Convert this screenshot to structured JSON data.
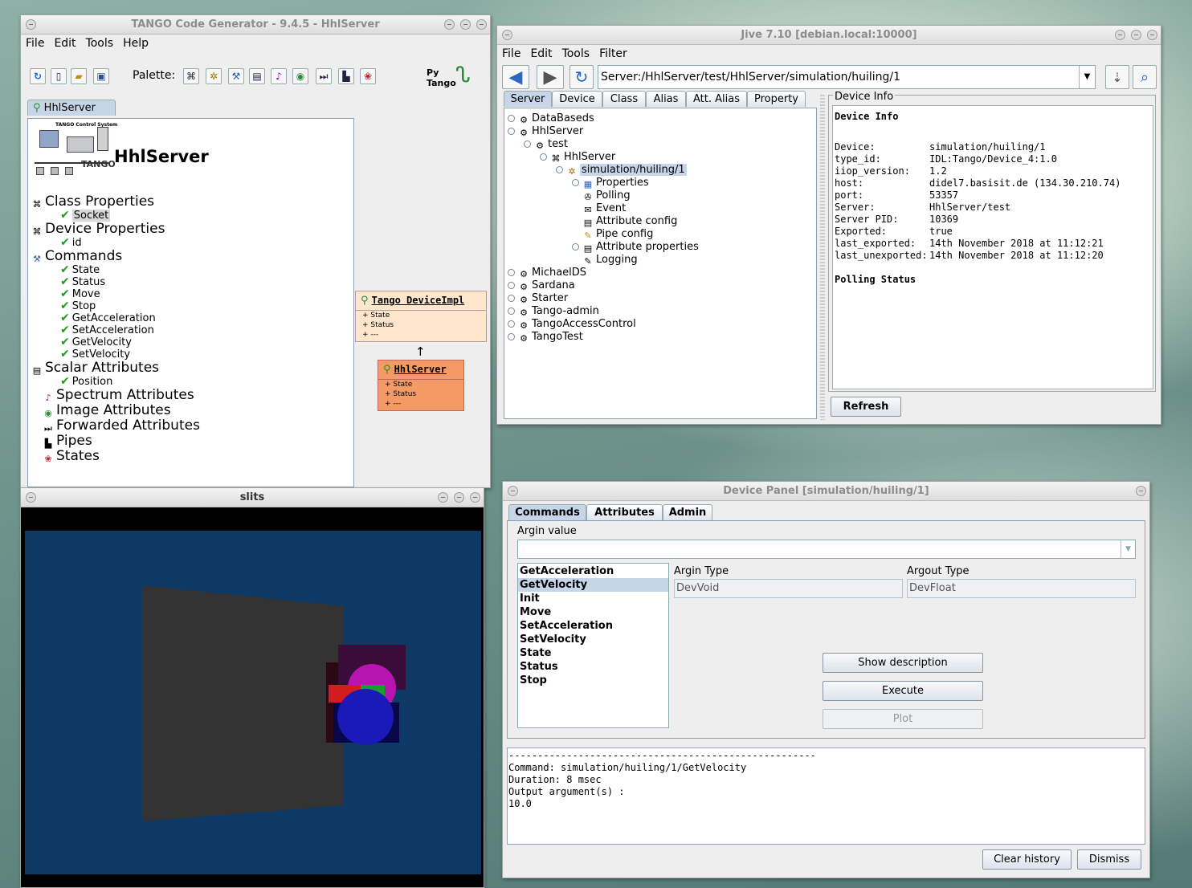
{
  "pogo": {
    "title": "TANGO Code Generator - 9.4.5   - HhlServer",
    "menu": [
      "File",
      "Edit",
      "Tools",
      "Help"
    ],
    "palette_label": "Palette:",
    "pytango_logo": "Py Tango",
    "tab": "HhlServer",
    "server_name": "HhlServer",
    "logo_caption": "TANGO Control System",
    "class_properties": "Class Properties",
    "class_property_items": [
      "Socket"
    ],
    "device_properties": "Device Properties",
    "device_property_items": [
      "id"
    ],
    "commands": "Commands",
    "command_items": [
      "State",
      "Status",
      "Move",
      "Stop",
      "GetAcceleration",
      "SetAcceleration",
      "GetVelocity",
      "SetVelocity"
    ],
    "scalar_attributes": "Scalar Attributes",
    "scalar_items": [
      "Position"
    ],
    "spectrum_attributes": "Spectrum Attributes",
    "image_attributes": "Image Attributes",
    "forwarded_attributes": "Forwarded Attributes",
    "pipes": "Pipes",
    "states": "States",
    "uml_parent": {
      "name": "Tango DeviceImpl",
      "rows": [
        "+ State",
        "+ Status",
        "+ ---"
      ]
    },
    "uml_child": {
      "name": "HhlServer",
      "rows": [
        "+ State",
        "+ Status",
        "+ ---"
      ]
    }
  },
  "slits": {
    "title": "slits"
  },
  "jive": {
    "title": "Jive 7.10 [debian.local:10000]",
    "menu": [
      "File",
      "Edit",
      "Tools",
      "Filter"
    ],
    "address": "Server:/HhlServer/test/HhlServer/simulation/huiling/1",
    "tabs": [
      "Server",
      "Device",
      "Class",
      "Alias",
      "Att. Alias",
      "Property"
    ],
    "tree": {
      "databaseds": "DataBaseds",
      "hhlserver": "HhlServer",
      "test": "test",
      "hhlserver_class": "HhlServer",
      "device": "simulation/huiling/1",
      "children": [
        "Properties",
        "Polling",
        "Event",
        "Attribute config",
        "Pipe config",
        "Attribute properties",
        "Logging"
      ],
      "others": [
        "MichaelDS",
        "Sardana",
        "Starter",
        "Tango-admin",
        "TangoAccessControl",
        "TangoTest"
      ]
    },
    "info_panel_title": "Device Info",
    "info_heading": "Device Info",
    "info_rows": [
      [
        "Device:",
        "simulation/huiling/1"
      ],
      [
        "type_id:",
        "IDL:Tango/Device_4:1.0"
      ],
      [
        "iiop_version:",
        "1.2"
      ],
      [
        "host:",
        "didel7.basisit.de (134.30.210.74)"
      ],
      [
        "port:",
        "53357"
      ],
      [
        "Server:",
        "HhlServer/test"
      ],
      [
        "Server PID:",
        "10369"
      ],
      [
        "Exported:",
        "true"
      ],
      [
        "last_exported:",
        "14th November 2018 at 11:12:21"
      ],
      [
        "last_unexported:",
        "14th November 2018 at 11:12:20"
      ]
    ],
    "polling_heading": "Polling Status",
    "refresh": "Refresh"
  },
  "panel": {
    "title": "Device Panel [simulation/huiling/1]",
    "tabs": [
      "Commands",
      "Attributes",
      "Admin"
    ],
    "argin_label": "Argin value",
    "argin_value": "",
    "commands": [
      "GetAcceleration",
      "GetVelocity",
      "Init",
      "Move",
      "SetAcceleration",
      "SetVelocity",
      "State",
      "Status",
      "Stop"
    ],
    "selected_command": "GetVelocity",
    "argin_type_label": "Argin Type",
    "argin_type": "DevVoid",
    "argout_type_label": "Argout Type",
    "argout_type": "DevFloat",
    "show_description": "Show description",
    "execute": "Execute",
    "plot": "Plot",
    "output": {
      "separator": "-----------------------------------------------------",
      "line1": "Command: simulation/huiling/1/GetVelocity",
      "line2": "Duration: 8 msec",
      "line3": "Output argument(s) :",
      "line4": "10.0"
    },
    "clear_history": "Clear history",
    "dismiss": "Dismiss"
  }
}
